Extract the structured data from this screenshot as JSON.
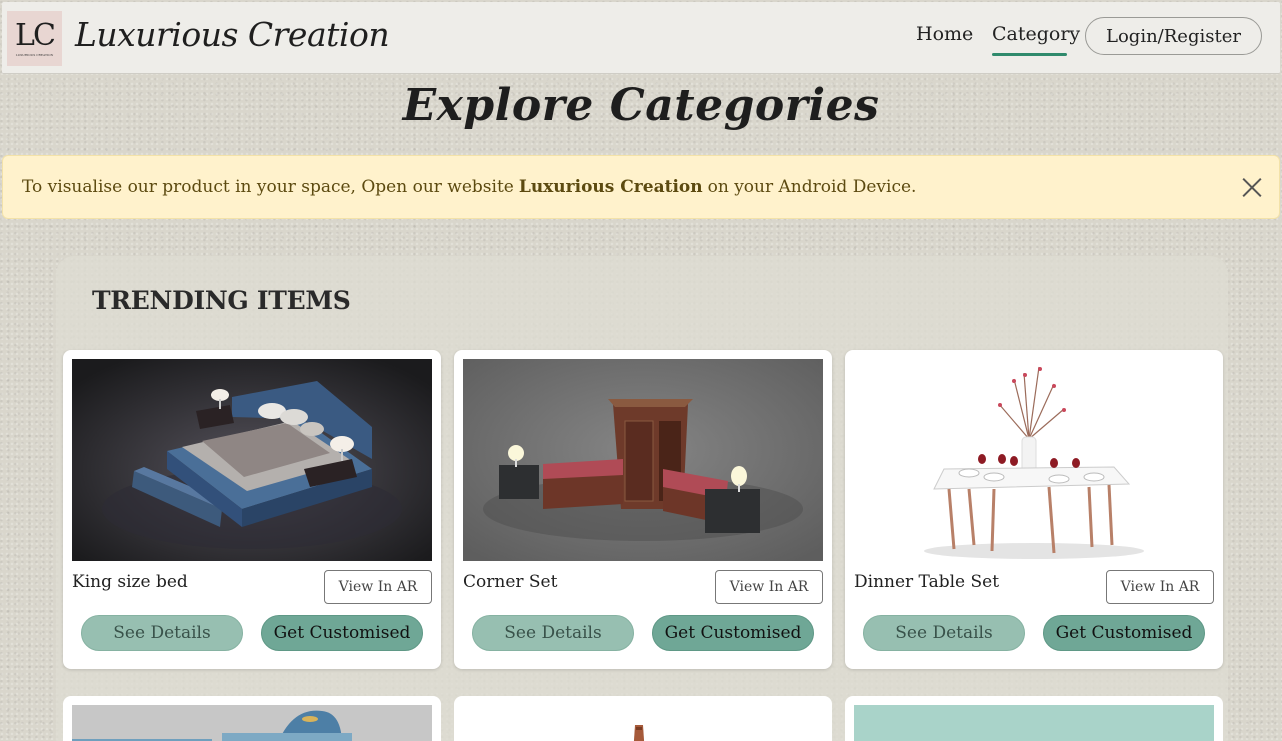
{
  "navbar": {
    "logo_letters": "LC",
    "logo_tagline": "LUXURIOUS CREATION",
    "brand": "Luxurious Creation",
    "links": {
      "home": "Home",
      "category": "Category"
    },
    "active_link": "Category",
    "login_label": "Login/Register",
    "accent_color": "#2f8a6c"
  },
  "page": {
    "title": "Explore Categories"
  },
  "alert": {
    "text_before": "To visualise our product in your space, Open our website",
    "highlight": "Luxurious Creation",
    "text_after": "on your Android Device.",
    "close_icon": "close-icon"
  },
  "trending": {
    "title": "TRENDING ITEMS",
    "items": [
      {
        "name": "King size bed",
        "ar_label": "View In AR",
        "details_label": "See Details",
        "custom_label": "Get Customised"
      },
      {
        "name": "Corner Set",
        "ar_label": "View In AR",
        "details_label": "See Details",
        "custom_label": "Get Customised"
      },
      {
        "name": "Dinner Table Set",
        "ar_label": "View In AR",
        "details_label": "See Details",
        "custom_label": "Get Customised"
      }
    ]
  }
}
